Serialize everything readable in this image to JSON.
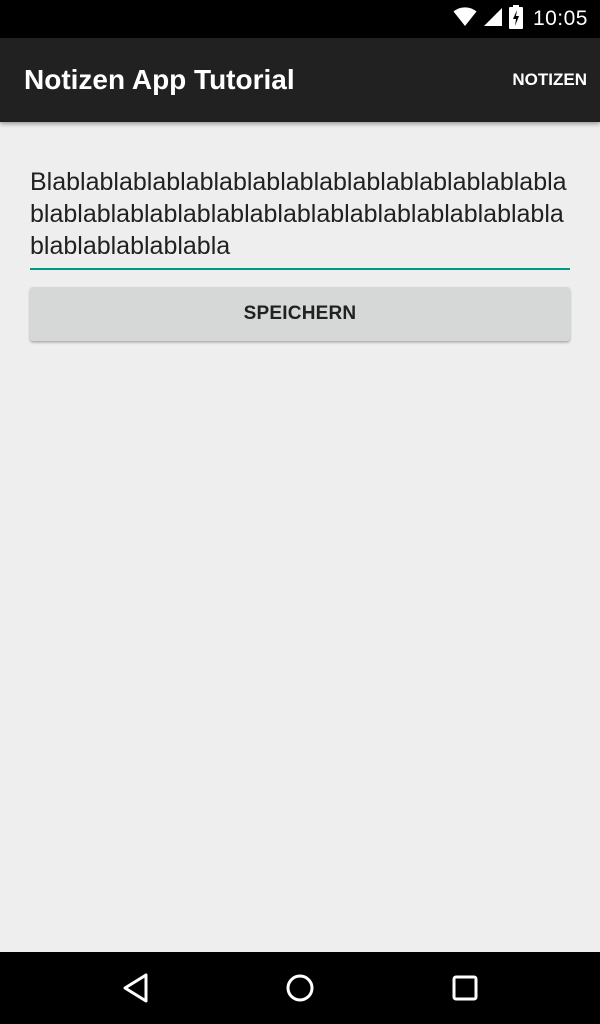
{
  "status_bar": {
    "time": "10:05",
    "icons": [
      "wifi-icon",
      "cell-signal-icon",
      "battery-charging-icon"
    ]
  },
  "app_bar": {
    "title": "Notizen App Tutorial",
    "action_label": "NOTIZEN"
  },
  "note": {
    "value": "Blablablablablablablablablablablablablablablablablablablablablablablablablablablablablablablablablablablablablabla"
  },
  "save_button": {
    "label": "SPEICHERN"
  },
  "colors": {
    "accent": "#009688",
    "app_bar": "#212121",
    "background": "#eeeeee",
    "button": "#d6d7d7"
  },
  "nav_bar": {
    "icons": [
      "back-icon",
      "home-icon",
      "recents-icon"
    ]
  }
}
